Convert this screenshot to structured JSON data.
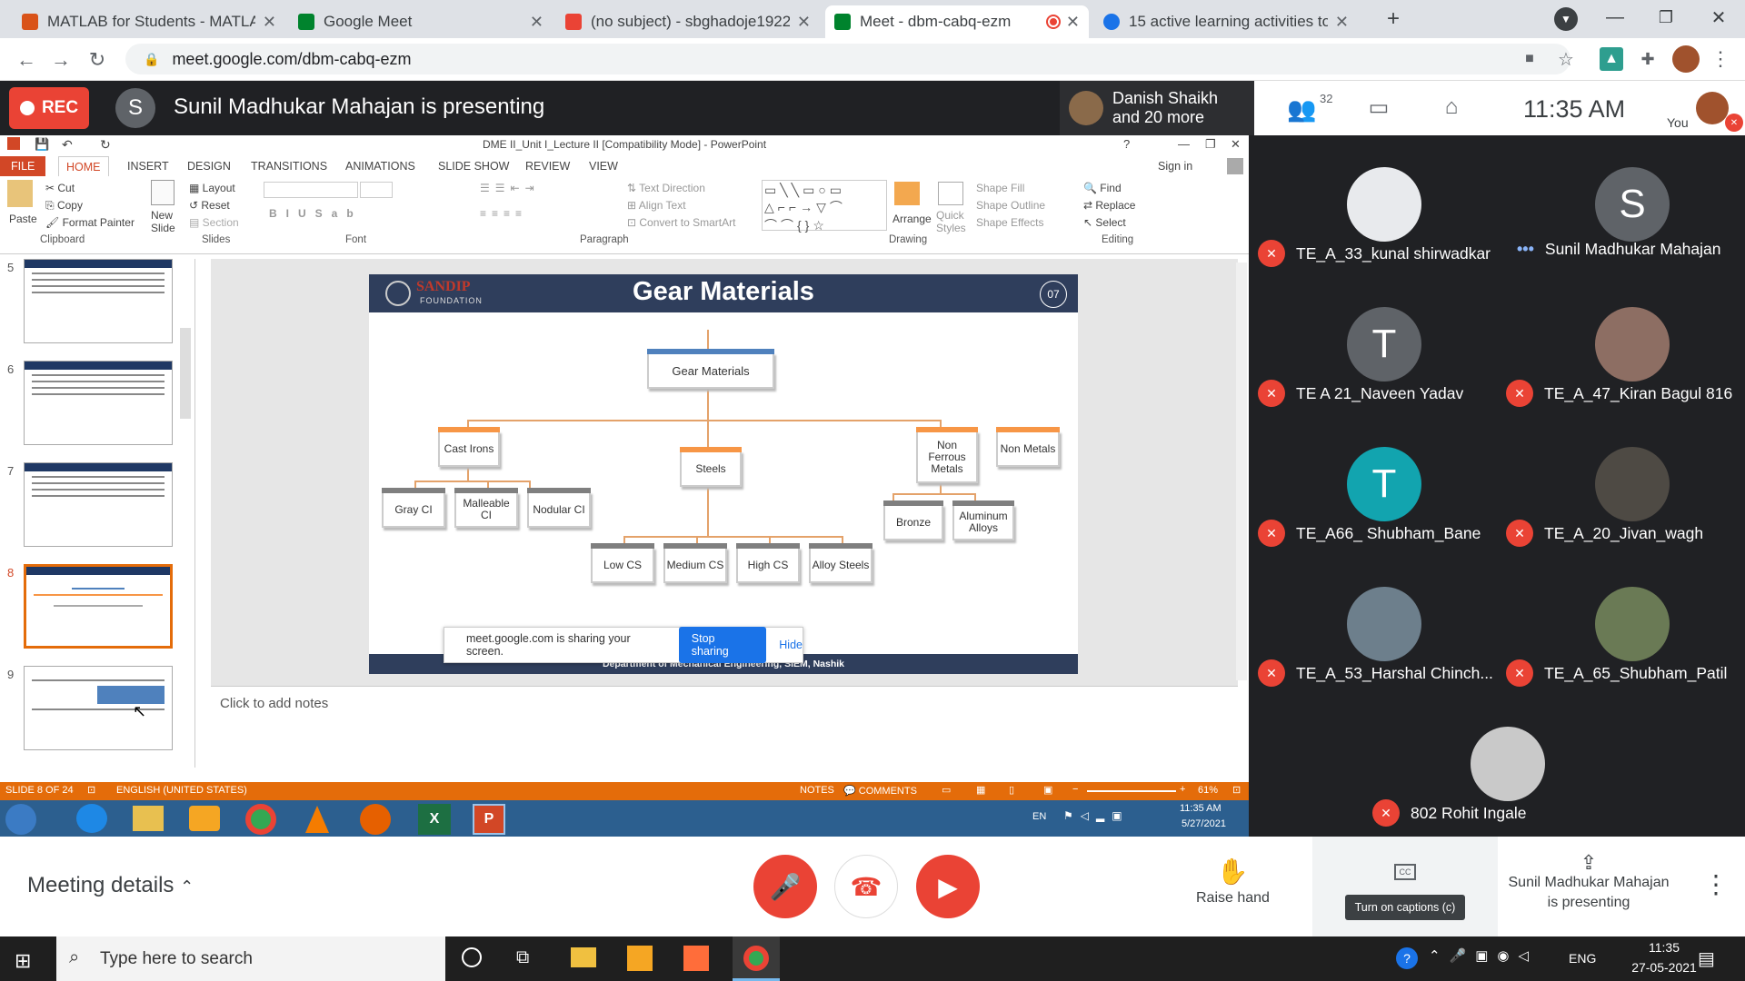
{
  "browser": {
    "tabs": [
      {
        "label": "MATLAB for Students - MATLAB & ",
        "color": "#d95319"
      },
      {
        "label": "Google Meet",
        "color": "#00832d"
      },
      {
        "label": "(no subject) - sbghadoje1922192",
        "color": "#ea4335"
      },
      {
        "label": "Meet - dbm-cabq-ezm",
        "color": "#00832d"
      },
      {
        "label": "15 active learning activities to en",
        "color": "#1a73e8"
      }
    ],
    "url": "meet.google.com/dbm-cabq-ezm"
  },
  "meet": {
    "rec_label": "REC",
    "presenter_initial": "S",
    "presenting_text": "Sunil Madhukar Mahajan is presenting",
    "speaker_name": "Danish Shaikh",
    "speaker_more": "and 20 more",
    "participant_count": "32",
    "time": "11:35 AM",
    "you_label": "You",
    "participants": [
      {
        "name": "TE_A_33_kunal shirwadkar",
        "initial": "",
        "color": "#e8eaed",
        "muted": true
      },
      {
        "name": "Sunil Madhukar Mahajan",
        "initial": "S",
        "color": "#5f6368",
        "muted": false
      },
      {
        "name": "TE A 21_Naveen Yadav",
        "initial": "T",
        "color": "#5f6368",
        "muted": true
      },
      {
        "name": "TE_A_47_Kiran Bagul 816",
        "initial": "",
        "color": "#8d6e63",
        "muted": true
      },
      {
        "name": "TE_A66_ Shubham_Bane",
        "initial": "T",
        "color": "#12a4af",
        "muted": true
      },
      {
        "name": "TE_A_20_Jivan_wagh",
        "initial": "",
        "color": "#4e4a44",
        "muted": true
      },
      {
        "name": "TE_A_53_Harshal Chinch...",
        "initial": "",
        "color": "#6d7f8c",
        "muted": true
      },
      {
        "name": "TE_A_65_Shubham_Patil",
        "initial": "",
        "color": "#6a7a55",
        "muted": true
      },
      {
        "name": "802 Rohit Ingale",
        "initial": "",
        "color": "#c9c9c9",
        "muted": true
      }
    ],
    "meeting_details": "Meeting details",
    "raise_hand": "Raise hand",
    "captions": "Turn on captions (c)",
    "presenting_short1": "Sunil Madhukar Mahajan",
    "presenting_short2": "is presenting",
    "share_notice": "meet.google.com is sharing your screen.",
    "stop_sharing": "Stop sharing",
    "hide": "Hide"
  },
  "ppt": {
    "title": "DME II_Unit I_Lecture II [Compatibility Mode] - PowerPoint",
    "tabs": [
      "FILE",
      "HOME",
      "INSERT",
      "DESIGN",
      "TRANSITIONS",
      "ANIMATIONS",
      "SLIDE SHOW",
      "REVIEW",
      "VIEW"
    ],
    "sign_in": "Sign in",
    "clipboard": {
      "paste": "Paste",
      "cut": "Cut",
      "copy": "Copy",
      "format_painter": "Format Painter",
      "group": "Clipboard"
    },
    "slides_grp": {
      "new_slide": "New Slide",
      "layout": "Layout",
      "reset": "Reset",
      "section": "Section",
      "group": "Slides"
    },
    "font_group": "Font",
    "paragraph": {
      "text_direction": "Text Direction",
      "align_text": "Align Text",
      "convert": "Convert to SmartArt",
      "group": "Paragraph"
    },
    "drawing": {
      "arrange": "Arrange",
      "quick_styles": "Quick Styles",
      "shape_fill": "Shape Fill",
      "shape_outline": "Shape Outline",
      "shape_effects": "Shape Effects",
      "group": "Drawing"
    },
    "editing": {
      "find": "Find",
      "replace": "Replace",
      "select": "Select",
      "group": "Editing"
    },
    "thumb_numbers": [
      "5",
      "6",
      "7",
      "8",
      "9"
    ],
    "notes_placeholder": "Click to add notes",
    "status_slide": "SLIDE 8 OF 24",
    "status_lang": "ENGLISH (UNITED STATES)",
    "status_notes": "NOTES",
    "status_comments": "COMMENTS",
    "zoom": "61%"
  },
  "slide": {
    "brand": "SANDIP",
    "brand_sub": "FOUNDATION",
    "title": "Gear Materials",
    "number": "07",
    "root": "Gear Materials",
    "cast_irons": "Cast Irons",
    "steels": "Steels",
    "non_ferrous": "Non Ferrous Metals",
    "non_metals": "Non Metals",
    "gray_ci": "Gray CI",
    "malleable_ci": "Malleable CI",
    "nodular_ci": "Nodular CI",
    "low_cs": "Low CS",
    "medium_cs": "Medium CS",
    "high_cs": "High CS",
    "alloy_steels": "Alloy Steels",
    "bronze": "Bronze",
    "aluminum_alloys": "Aluminum Alloys",
    "footer": "Department of Mechanical Engineering, SIEM, Nashik"
  },
  "win7": {
    "lang": "EN",
    "time": "11:35 AM",
    "date": "5/27/2021"
  },
  "win10": {
    "search_placeholder": "Type here to search",
    "lang": "ENG",
    "time": "11:35",
    "date": "27-05-2021"
  }
}
